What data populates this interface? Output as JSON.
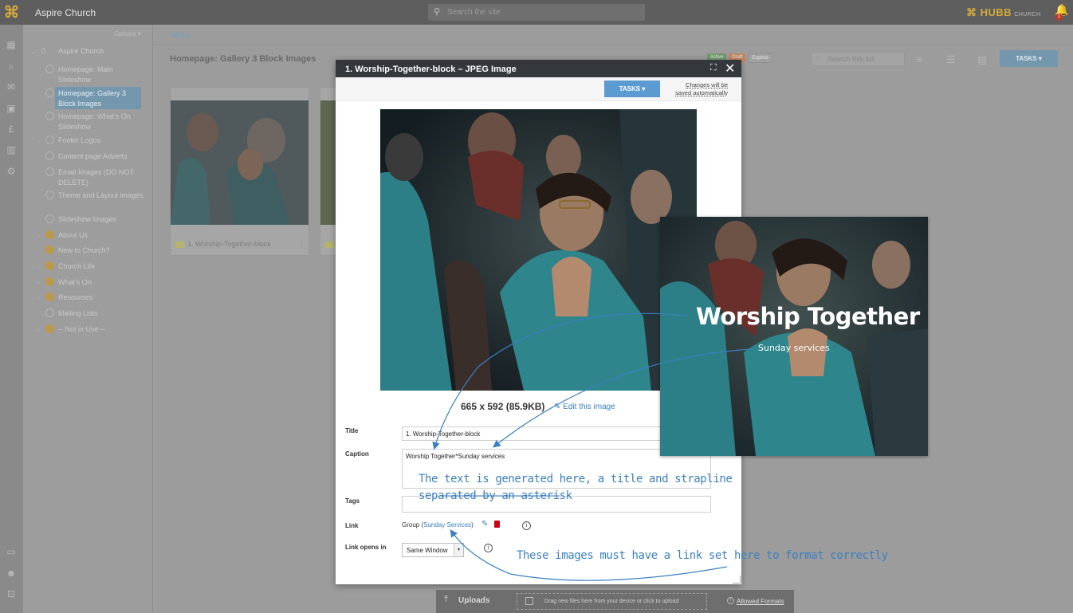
{
  "topbar": {
    "site_name": "Aspire Church",
    "search_placeholder": "Search the site",
    "brand": "HUBB",
    "brand_suffix": "CHURCH",
    "notif_count": "1"
  },
  "tree": {
    "options_label": "Options",
    "root": "Aspire Church",
    "items": [
      {
        "label": "Homepage: Main Slideshow"
      },
      {
        "label": "Homepage: Gallery 3 Block Images"
      },
      {
        "label": "Homepage: What's On Slideshow"
      },
      {
        "label": "Footer Logos"
      },
      {
        "label": "Content page Adverts"
      },
      {
        "label": "Email Images (DO NOT DELETE)"
      },
      {
        "label": "Theme and Layout images"
      },
      {
        "label": "Slideshow Images"
      },
      {
        "label": "About Us"
      },
      {
        "label": "New to Church?"
      },
      {
        "label": "Church Life"
      },
      {
        "label": "What's On"
      },
      {
        "label": "Resources"
      },
      {
        "label": "Mailing Lists"
      },
      {
        "label": "-- Not in Use --"
      }
    ]
  },
  "main": {
    "tab": "MEDIA",
    "heading": "Homepage: Gallery 3 Block Images",
    "chips": [
      "Active",
      "Draft",
      "Expired"
    ],
    "list_search_placeholder": "Search this list",
    "tasks_label": "TASKS",
    "card_caption": "1. Worship-Together-block"
  },
  "modal": {
    "title": "1. Worship-Together-block – JPEG Image",
    "tasks_label": "TASKS",
    "autosave_line1": "Changes will be",
    "autosave_line2": "saved automatically",
    "dimensions": "665 x 592 (85.9KB)",
    "edit_link": "Edit this image",
    "fields": {
      "title_label": "Title",
      "title_value": "1. Worship-Together-block",
      "caption_label": "Caption",
      "caption_value": "Worship Together*Sunday services",
      "tags_label": "Tags",
      "tags_value": "",
      "link_label": "Link",
      "link_prefix": "Group (",
      "link_text": "Sunday Services",
      "link_suffix": ")",
      "link_opens_label": "Link opens in",
      "link_opens_value": "Same Window"
    }
  },
  "uploads": {
    "label": "Uploads",
    "drop_text": "Drag new files here from your device or click to upload",
    "allowed": "Allowed Formats"
  },
  "demo": {
    "title": "Worship Together",
    "subtitle": "Sunday services"
  },
  "annotations": {
    "caption_note_1": "The text is generated here, a title and strapline",
    "caption_note_2": "separated by an asterisk",
    "link_note": "These images must have a link set here to format correctly"
  },
  "colors": {
    "accent": "#5b9bd1",
    "annotation": "#3a7fc1",
    "brand": "#d4a93b"
  }
}
